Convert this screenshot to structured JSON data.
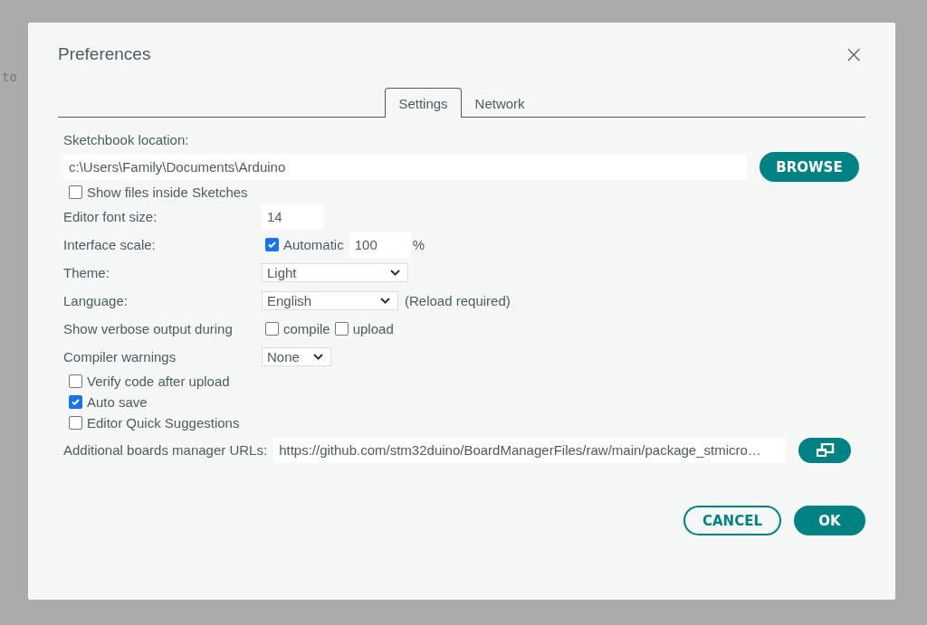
{
  "background_editor": {
    "text": "to"
  },
  "dialog": {
    "title": "Preferences",
    "close": "×"
  },
  "tabs": [
    {
      "label": "Settings",
      "selected": true
    },
    {
      "label": "Network",
      "selected": false
    }
  ],
  "settings": [
    {
      "kind": "path",
      "label": "Sketchbook location:",
      "value": "c:\\Users\\Family\\Documents\\Arduino",
      "button": "BROWSE"
    },
    {
      "kind": "checkbox",
      "label": "Show files inside Sketches",
      "checked": false
    },
    {
      "kind": "number",
      "label": "Editor font size:",
      "value": "14"
    },
    {
      "kind": "scale",
      "label": "Interface scale:",
      "option": {
        "label": "Automatic",
        "checked": true
      },
      "value": "100",
      "unit": "%"
    },
    {
      "kind": "select",
      "label": "Theme:",
      "value": "Light"
    },
    {
      "kind": "select",
      "label": "Language:",
      "value": "English",
      "note": "(Reload required)"
    },
    {
      "kind": "checks",
      "label": "Show verbose output during",
      "options": [
        {
          "label": "compile",
          "checked": false
        },
        {
          "label": "upload",
          "checked": false
        }
      ]
    },
    {
      "kind": "select",
      "label": "Compiler warnings",
      "value": "None"
    },
    {
      "kind": "checkbox",
      "label": "Verify code after upload",
      "checked": false
    },
    {
      "kind": "checkbox",
      "label": "Auto save",
      "checked": true
    },
    {
      "kind": "checkbox",
      "label": "Editor Quick Suggestions",
      "checked": false
    },
    {
      "kind": "urls",
      "label": "Additional boards manager URLs:",
      "value": "https://github.com/stm32duino/BoardManagerFiles/raw/main/package_stmicro…"
    }
  ],
  "buttons": [
    {
      "label": "CANCEL",
      "kind": "secondary"
    },
    {
      "label": "OK",
      "kind": "primary"
    }
  ]
}
